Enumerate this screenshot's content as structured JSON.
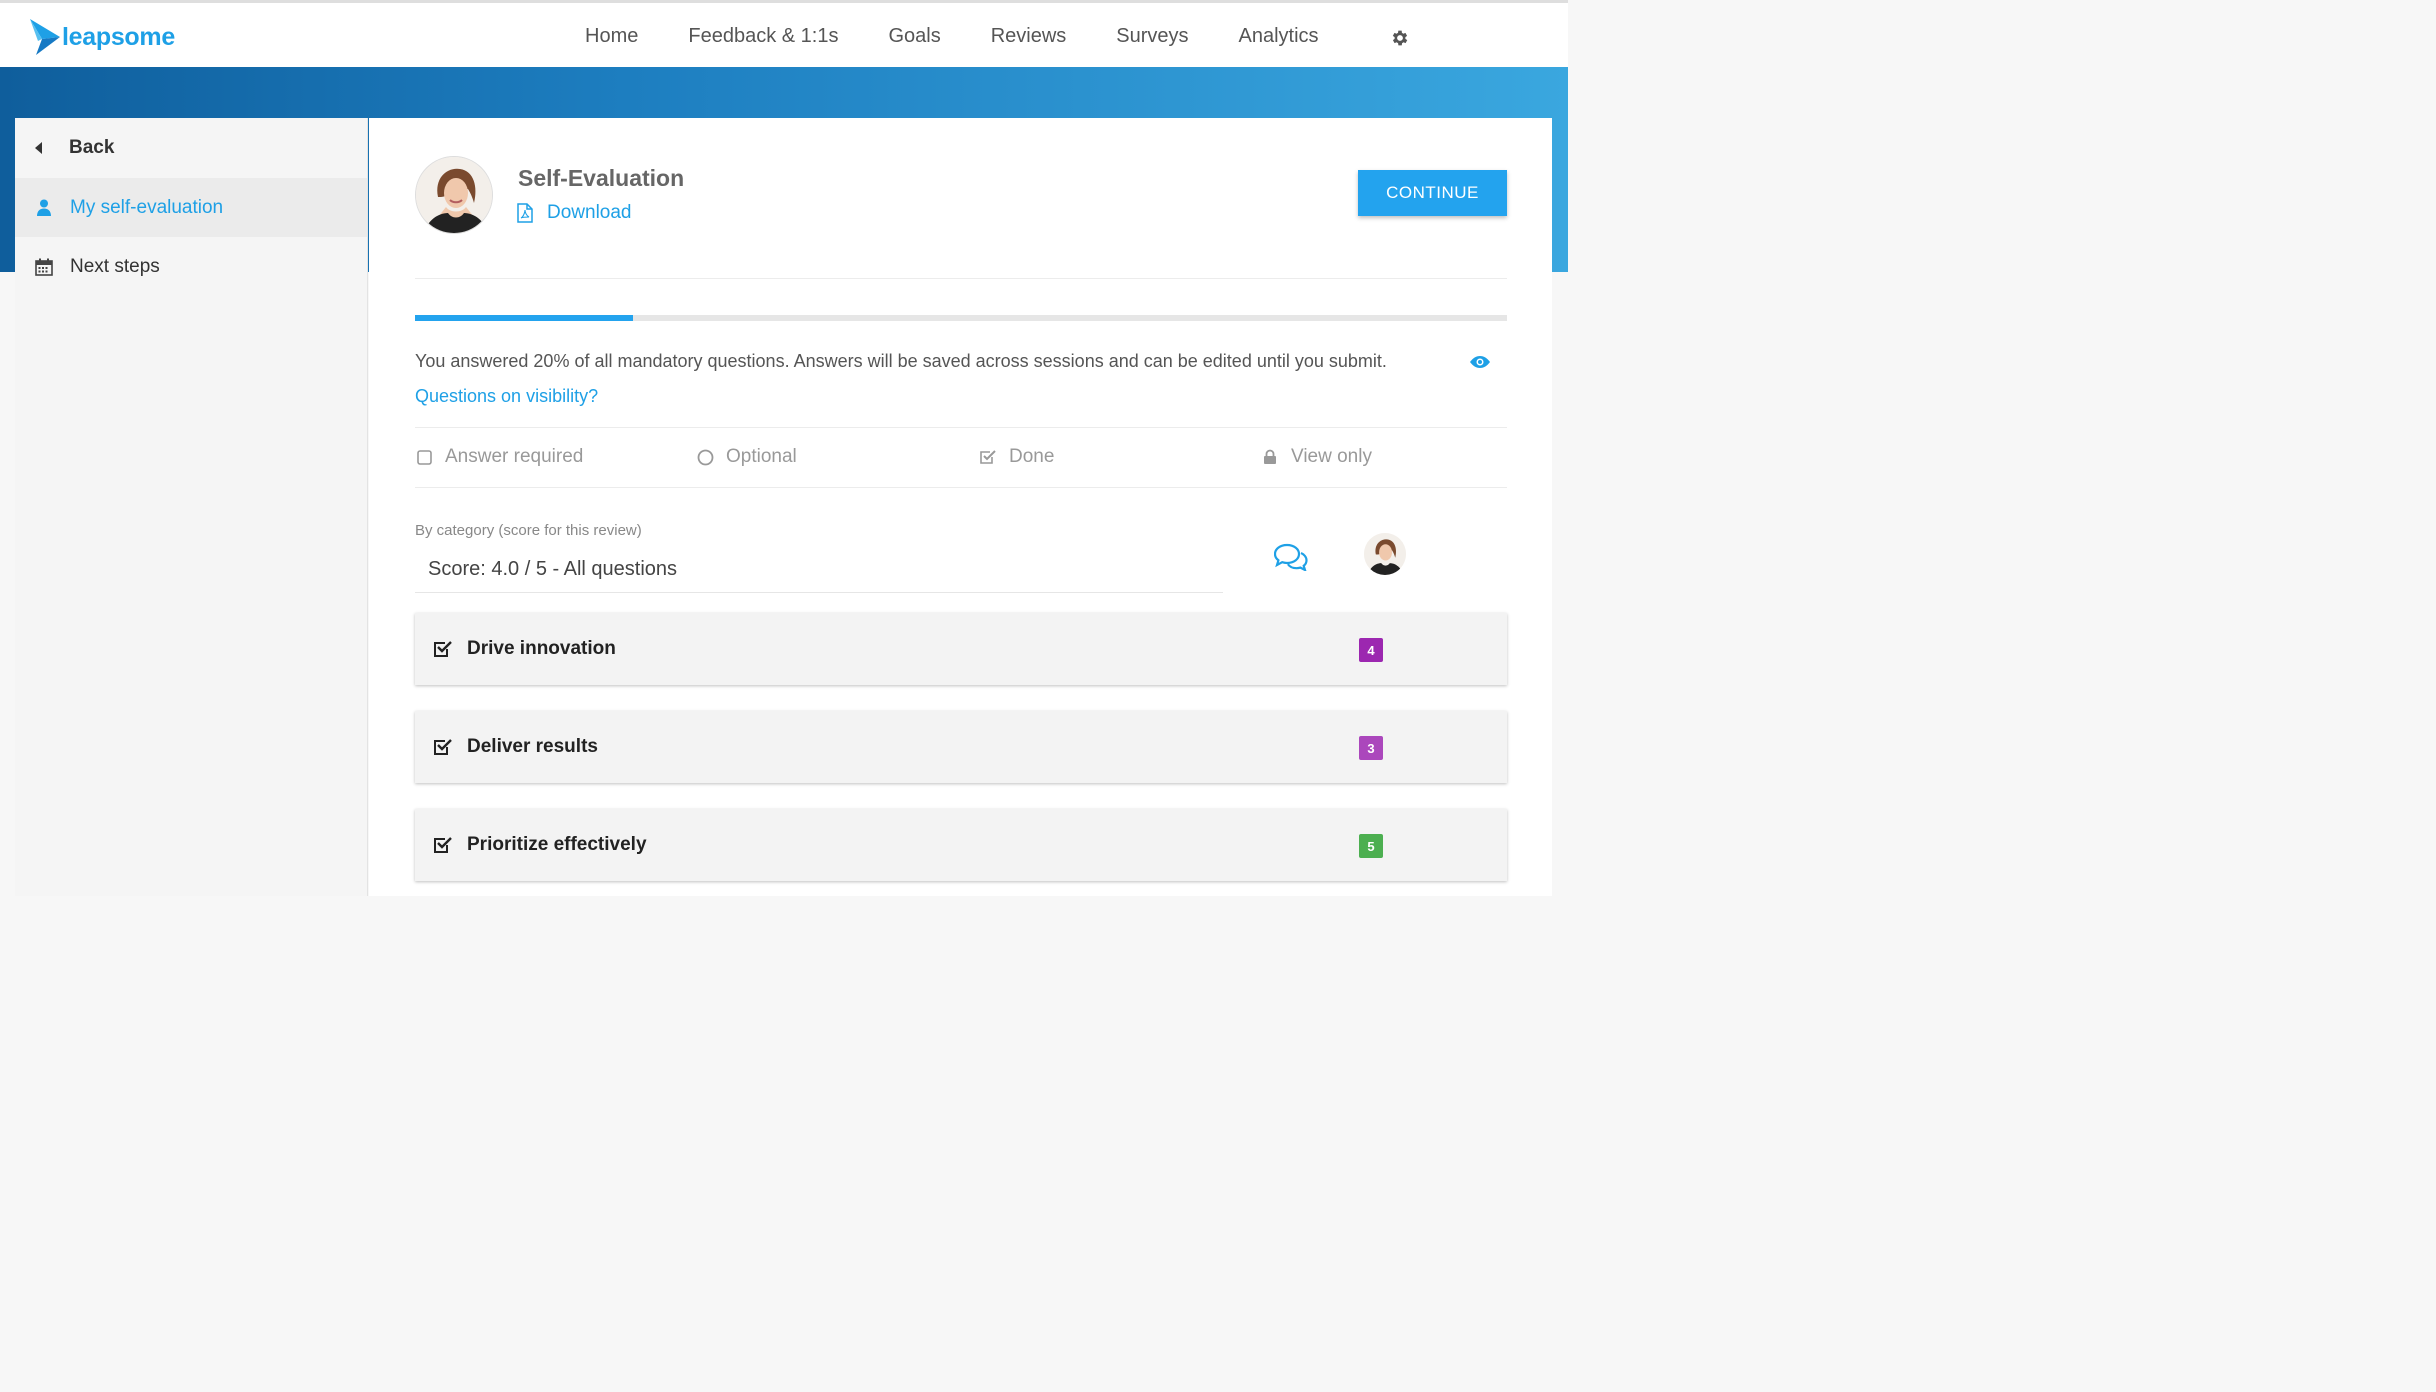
{
  "brand": {
    "name": "leapsome",
    "accent": "#1ea0e6"
  },
  "nav": {
    "items": [
      {
        "label": "Home"
      },
      {
        "label": "Feedback & 1:1s"
      },
      {
        "label": "Goals"
      },
      {
        "label": "Reviews"
      },
      {
        "label": "Surveys"
      },
      {
        "label": "Analytics"
      }
    ],
    "settings_icon": "gear-icon"
  },
  "sidebar": {
    "back_label": "Back",
    "items": [
      {
        "label": "My self-evaluation",
        "icon": "user-icon",
        "active": true
      },
      {
        "label": "Next steps",
        "icon": "calendar-icon",
        "active": false
      }
    ]
  },
  "header": {
    "title": "Self-Evaluation",
    "download_label": "Download",
    "continue_label": "CONTINUE"
  },
  "progress": {
    "percent": 20,
    "text": "You answered 20% of all mandatory questions. Answers will be saved across sessions and can be edited until you submit.",
    "visibility_link": "Questions on visibility?"
  },
  "legend": {
    "items": [
      {
        "label": "Answer required",
        "icon": "empty-checkbox-icon"
      },
      {
        "label": "Optional",
        "icon": "circle-icon"
      },
      {
        "label": "Done",
        "icon": "checked-box-icon"
      },
      {
        "label": "View only",
        "icon": "lock-icon"
      }
    ]
  },
  "category": {
    "label": "By category (score for this review)",
    "score_text": "Score: 4.0 / 5 - All questions"
  },
  "categories": [
    {
      "name": "Drive innovation",
      "score": "4",
      "color": "#9c27b0"
    },
    {
      "name": "Deliver results",
      "score": "3",
      "color": "#ab47bc"
    },
    {
      "name": "Prioritize effectively",
      "score": "5",
      "color": "#4caf50"
    }
  ]
}
